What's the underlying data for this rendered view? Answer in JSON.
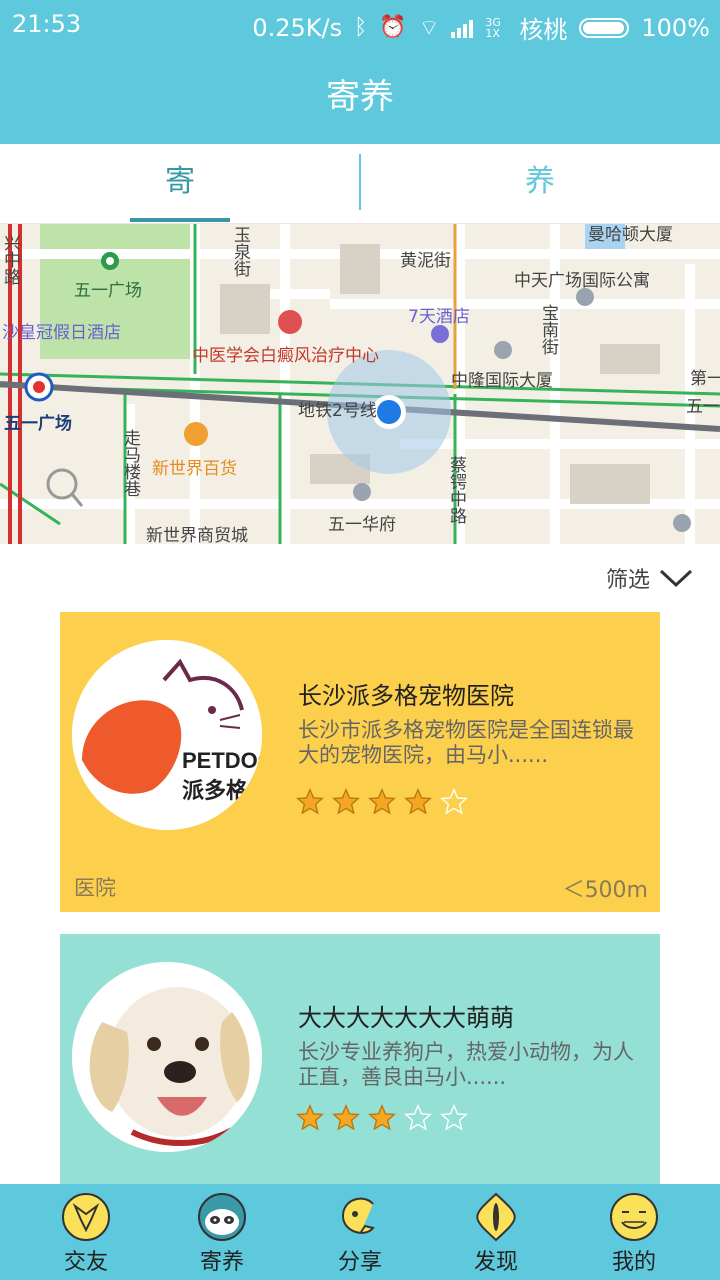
{
  "status_bar": {
    "time": "21:53",
    "speed": "0.25K/s",
    "network": "3G 1X",
    "carrier": "核桃",
    "battery": "100%"
  },
  "app_bar": {
    "title": "寄养"
  },
  "tabs": [
    {
      "label": "寄",
      "active": true
    },
    {
      "label": "养",
      "active": false
    }
  ],
  "map": {
    "labels": {
      "wuyi_square": "五一广场",
      "holiday_inn": "沙皇冠假日酒店",
      "hospital": "中医学会白癜风治疗中心",
      "huangni_street": "黄泥街",
      "seven_days": "7天酒店",
      "zhongtian": "中天广场国际公寓",
      "manhattan": "曼哈顿大厦",
      "zhonglong": "中隆国际大厦",
      "metro_line": "地铁2号线",
      "metro_station": "五一广场",
      "xinshijie": "新世界百货",
      "xinshijie_trade": "新世界商贸城",
      "wuyi_huafu": "五一华府",
      "zoumalou": "走马楼巷",
      "caie_road": "蔡锷中路",
      "yuquan": "玉泉街",
      "baonan": "宝南街",
      "di_yi": "第一",
      "wu_yi": "五一",
      "xingzhong": "兴中路"
    }
  },
  "filter": {
    "label": "筛选"
  },
  "cards": [
    {
      "title": "长沙派多格宠物医院",
      "description": "长沙市派多格宠物医院是全国连锁最大的宠物医院，由马小......",
      "rating": 4,
      "max_rating": 5,
      "tag": "医院",
      "distance": "＜500m",
      "logo_text": "PETDOG",
      "logo_cn": "派多格",
      "background": "#fcd04d"
    },
    {
      "title": "大大大大大大大萌萌",
      "description": "长沙专业养狗户，热爱小动物，为人正直，善良由马小......",
      "rating": 3,
      "max_rating": 5,
      "background": "#94e0d4"
    }
  ],
  "bottom_nav": [
    {
      "label": "交友",
      "icon": "fox-icon"
    },
    {
      "label": "寄养",
      "icon": "panda-icon"
    },
    {
      "label": "分享",
      "icon": "share-hook-icon"
    },
    {
      "label": "发现",
      "icon": "cat-eye-icon"
    },
    {
      "label": "我的",
      "icon": "smiley-face-icon"
    }
  ],
  "colors": {
    "primary": "#5ec8dc",
    "tab_active": "#3a97a8",
    "card_yellow": "#fcd04d",
    "card_teal": "#94e0d4",
    "star": "#f5a623"
  }
}
